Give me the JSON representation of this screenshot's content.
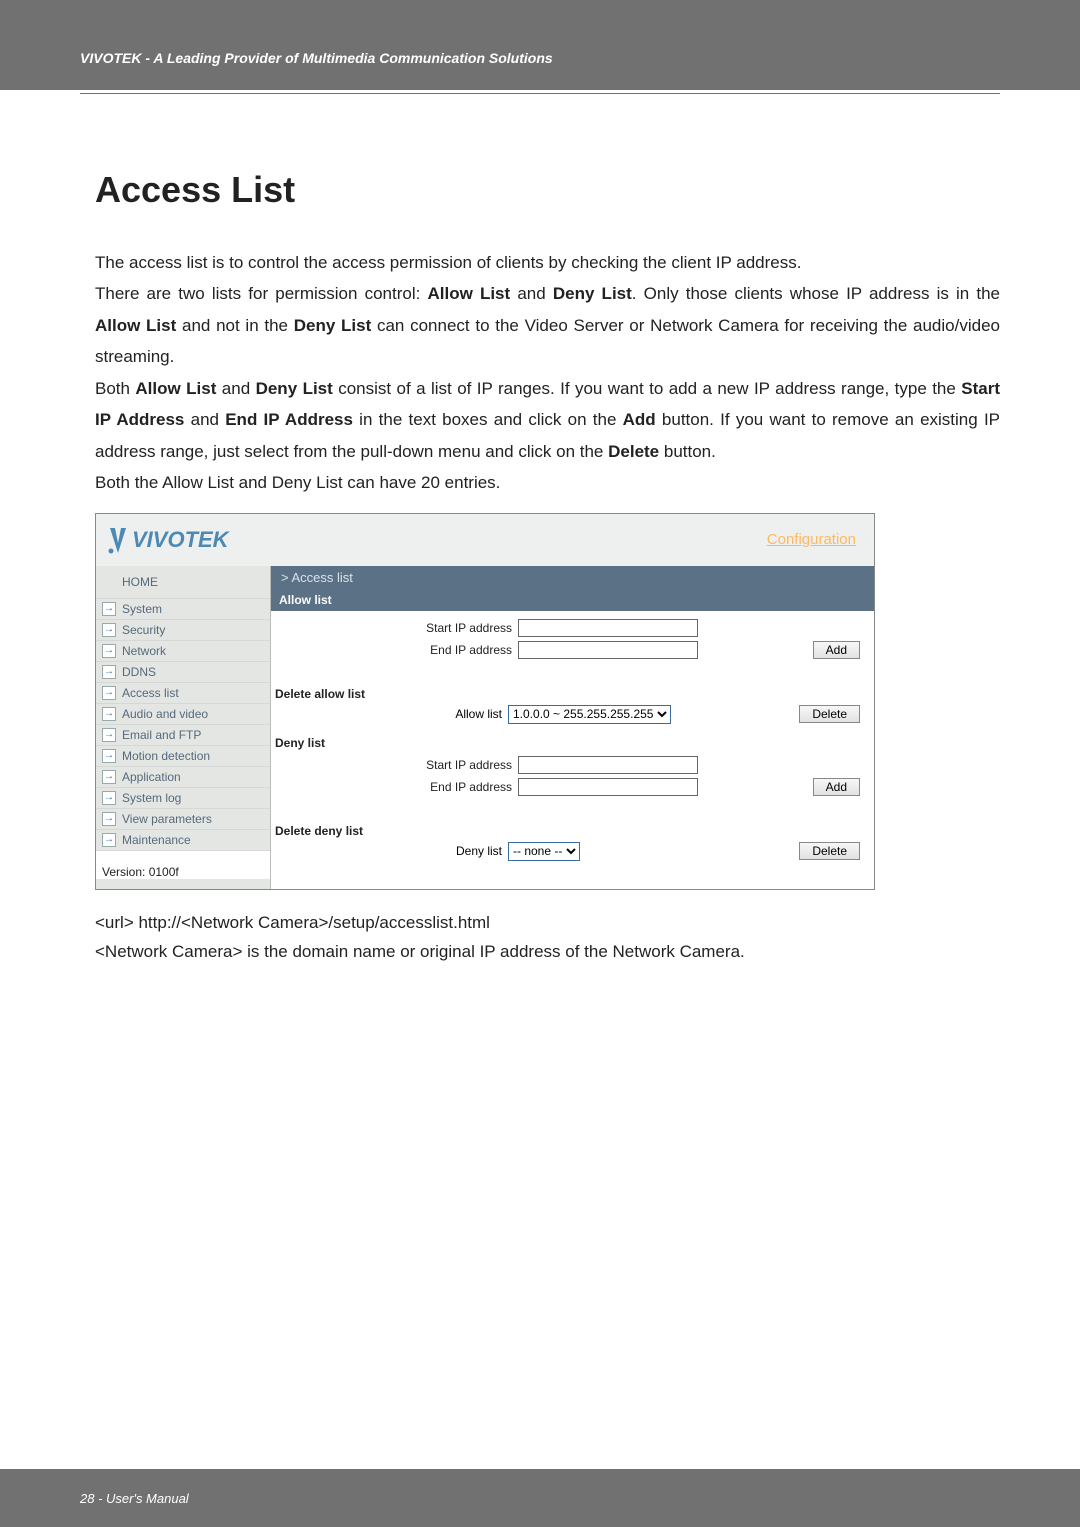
{
  "header_banner": "VIVOTEK - A Leading Provider of Multimedia Communication Solutions",
  "title": "Access List",
  "para1": "The access list is to control the access permission of clients by checking the client IP address.",
  "para2_pre": "There are two lists for permission control: ",
  "allow_list_b": "Allow List",
  "para2_mid1": " and ",
  "deny_list_b": "Deny List",
  "para2_mid2": ". Only those clients whose IP address is in the ",
  "para2_mid3": " and not in the ",
  "para2_end": " can connect to the Video Server or Network Camera for receiving the audio/video streaming.",
  "para3_pre": "Both ",
  "para3_mid1": " and ",
  "para3_mid2": " consist of a list of IP ranges. If you want to add a new IP address range, type the ",
  "start_ip_b": "Start IP Address",
  "para3_mid3": " and ",
  "end_ip_b": "End IP Address",
  "para3_mid4": " in the text boxes and click on the ",
  "add_b": "Add",
  "para3_mid5": " button. If you want to remove an existing IP address range, just select from the pull-down menu and click on the ",
  "delete_b": "Delete",
  "para3_end": " button.",
  "para4": "Both the Allow List and Deny List can have 20 entries.",
  "screenshot": {
    "brand": "VIVOTEK",
    "config_link": "Configuration",
    "nav": {
      "home": "HOME",
      "items": [
        "System",
        "Security",
        "Network",
        "DDNS",
        "Access list",
        "Audio and video",
        "Email and FTP",
        "Motion detection",
        "Application",
        "System log",
        "View parameters",
        "Maintenance"
      ]
    },
    "version": "Version: 0100f",
    "breadcrumb": "> Access list",
    "allow_section": "Allow list",
    "start_ip_label": "Start IP address",
    "end_ip_label": "End IP address",
    "add_btn": "Add",
    "delete_allow_heading": "Delete allow list",
    "allow_list_label": "Allow list",
    "allow_select_value": "1.0.0.0 ~ 255.255.255.255",
    "delete_btn": "Delete",
    "deny_section": "Deny list",
    "delete_deny_heading": "Delete deny list",
    "deny_list_label": "Deny list",
    "deny_select_value": "-- none --"
  },
  "url_line": "<url> http://<Network Camera>/setup/accesslist.html",
  "url_note": "<Network Camera> is the domain name or original IP address of the Network Camera.",
  "footer": "28 - User's Manual"
}
